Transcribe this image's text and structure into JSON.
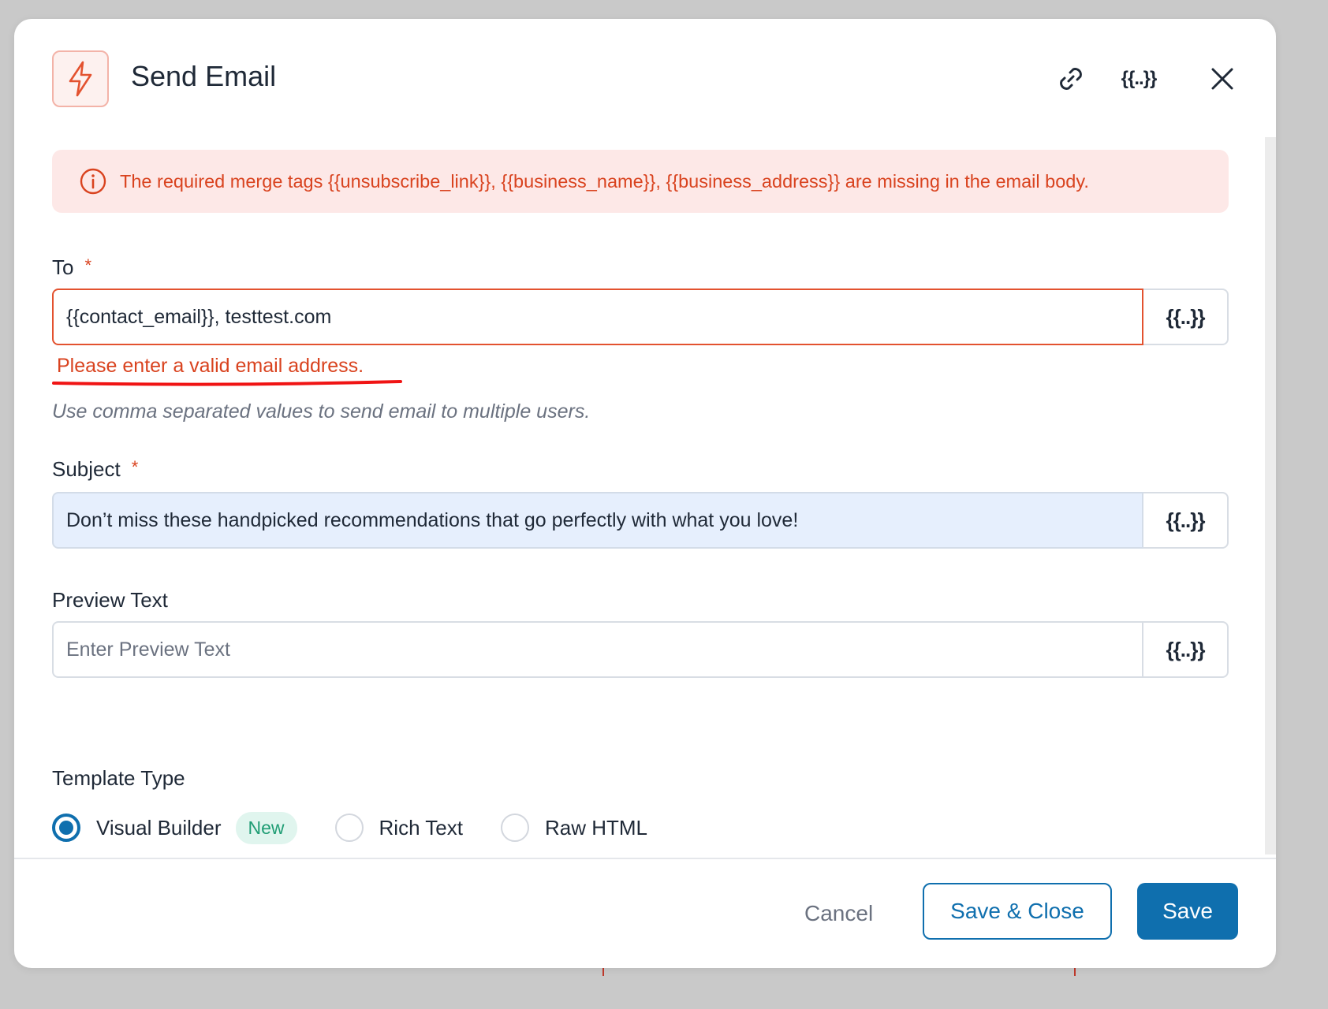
{
  "dialog": {
    "title": "Send Email",
    "header_merge_tag_label": "{{..}}",
    "header_icon": "lightning-bolt-icon",
    "link_icon": "link-icon",
    "close_icon": "close-icon"
  },
  "alert": {
    "icon": "info-circle-icon",
    "message": "The required merge tags {{unsubscribe_link}}, {{business_name}}, {{business_address}} are missing in the email body."
  },
  "fields": {
    "to": {
      "label": "To",
      "required_mark": "*",
      "value": "{{contact_email}}, testtest.com",
      "merge_tag_label": "{{..}}",
      "error": "Please enter a valid email address.",
      "help": "Use comma separated values to send email to multiple users."
    },
    "subject": {
      "label": "Subject",
      "required_mark": "*",
      "value": "Don’t miss these handpicked recommendations that go perfectly with what you love!",
      "merge_tag_label": "{{..}}"
    },
    "preview_text": {
      "label": "Preview Text",
      "placeholder": "Enter Preview Text",
      "merge_tag_label": "{{..}}"
    }
  },
  "template_type": {
    "label": "Template Type",
    "options": [
      {
        "label": "Visual Builder",
        "badge": "New",
        "selected": true
      },
      {
        "label": "Rich Text",
        "selected": false
      },
      {
        "label": "Raw HTML",
        "selected": false
      }
    ]
  },
  "footer": {
    "cancel_label": "Cancel",
    "save_close_label": "Save & Close",
    "save_label": "Save"
  },
  "colors": {
    "primary": "#0f6fae",
    "error": "#d9431f",
    "alert_bg": "#fde8e7",
    "badge_bg": "#e0f5ee",
    "badge_text": "#1f9d74"
  }
}
